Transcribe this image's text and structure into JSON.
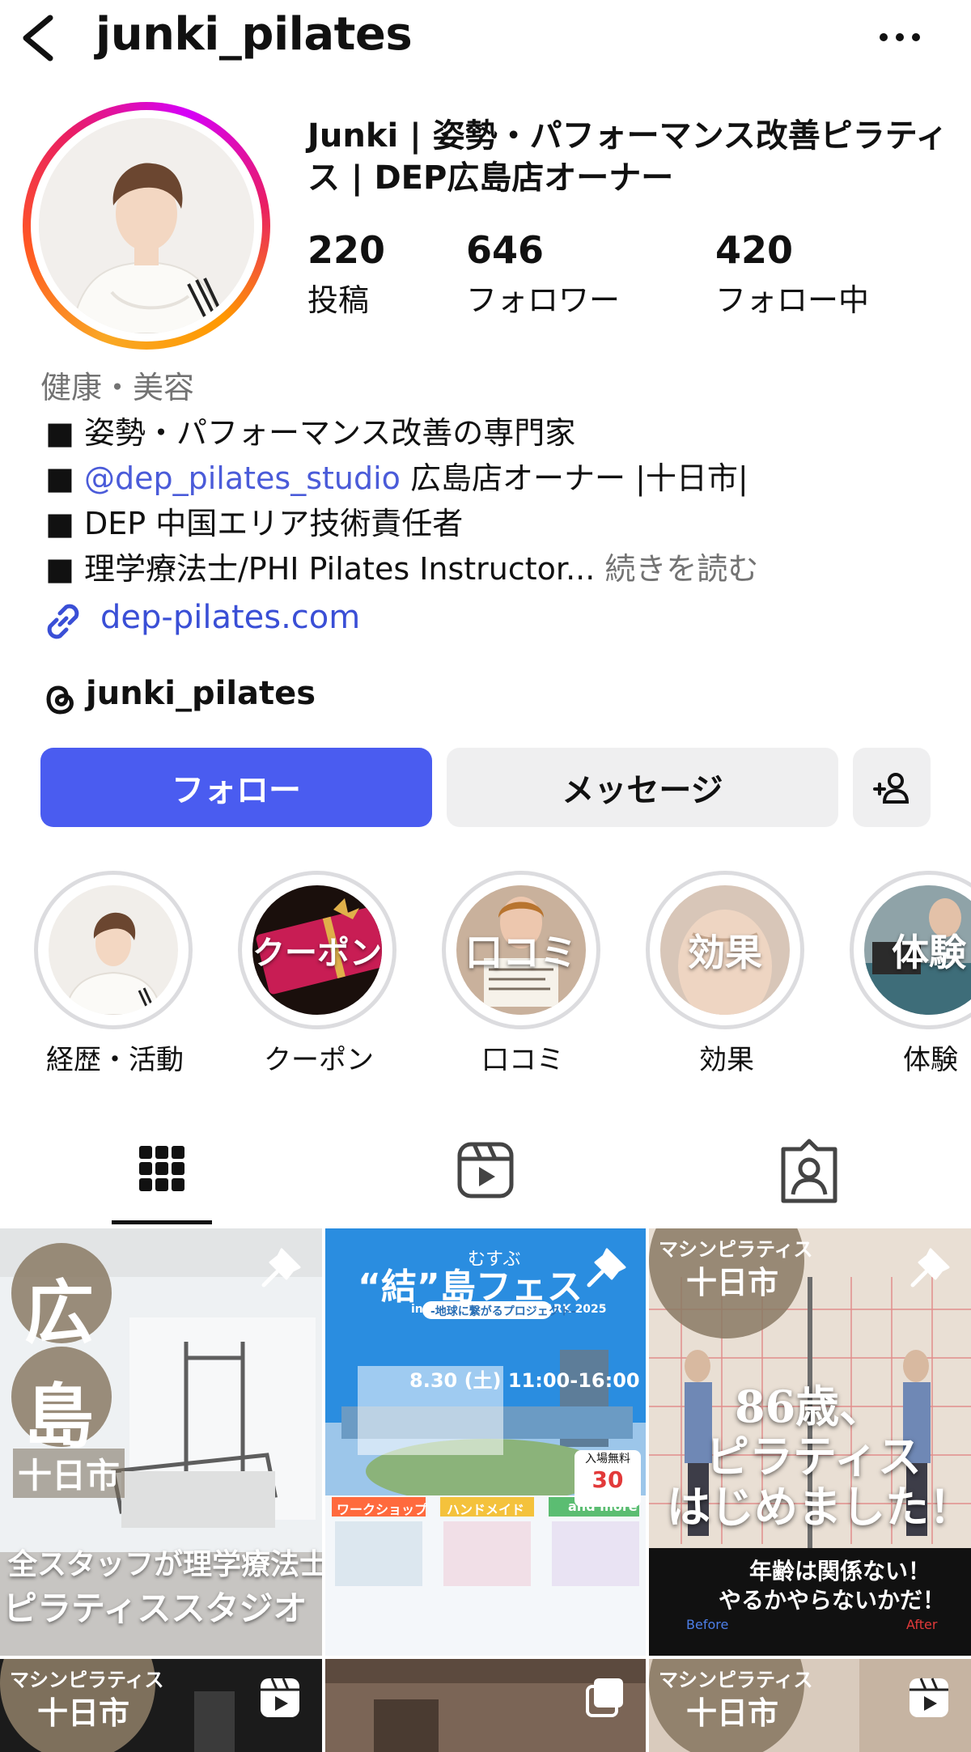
{
  "header": {
    "username": "junki_pilates",
    "back_icon": "chevron-left-icon",
    "more_icon": "ellipsis-icon"
  },
  "profile": {
    "display_name": "Junki | 姿勢・パフォーマンス改善ピラティス | DEP広島店オーナー",
    "stats": [
      {
        "value": "220",
        "label": "投稿"
      },
      {
        "value": "646",
        "label": "フォロワー"
      },
      {
        "value": "420",
        "label": "フォロー中"
      }
    ],
    "category": "健康・美容",
    "bio": {
      "line1": "■ 姿勢・パフォーマンス改善の専門家",
      "line2_prefix": "■ ",
      "line2_mention": "@dep_pilates_studio",
      "line2_suffix": " 広島店オーナー |十日市|",
      "line3": "■ DEP 中国エリア技術責任者",
      "line4": "■ 理学療法士/PHI Pilates Instructor...",
      "more": "続きを読む"
    },
    "link": "dep-pilates.com",
    "threads": "junki_pilates"
  },
  "buttons": {
    "follow": "フォロー",
    "message": "メッセージ"
  },
  "highlights": [
    {
      "label": "経歴・活動",
      "overlay": ""
    },
    {
      "label": "クーポン",
      "overlay": "クーポン"
    },
    {
      "label": "口コミ",
      "overlay": "口コミ"
    },
    {
      "label": "効果",
      "overlay": "効果"
    },
    {
      "label": "体験",
      "overlay": "体験"
    }
  ],
  "tabs": [
    "grid-icon",
    "reels-icon",
    "tagged-icon"
  ],
  "posts": {
    "p1": {
      "big1": "広",
      "big2": "島",
      "sub": "十日市",
      "line1": "全スタッフが理学療法士の",
      "line2": "ピラティススタジオ"
    },
    "p2": {
      "kicker": "むすぶ",
      "title": "“結”島フェス",
      "venue": "in HIROSHIMA GATEPARK 2025",
      "tagline": "-地球に繋がるプロジェクト-",
      "date": "8.30 (土) 11:00-16:00",
      "badge_top": "入場無料",
      "badge_num": "30",
      "tag1": "ワークショップ",
      "tag2": "ハンドメイド",
      "tag3": "and more"
    },
    "p3": {
      "top": "マシンピラティス",
      "place": "十日市",
      "line1": "86歳、",
      "line2": "ピラティス",
      "line3": "はじめました！",
      "caption1": "年齢は関係ない！",
      "caption2": "やるかやらないかだ！",
      "before": "Before",
      "after": "After"
    },
    "p4": {
      "top": "マシンピラティス",
      "place": "十日市"
    },
    "p6": {
      "top": "マシンピラティス",
      "place": "十日市"
    }
  }
}
